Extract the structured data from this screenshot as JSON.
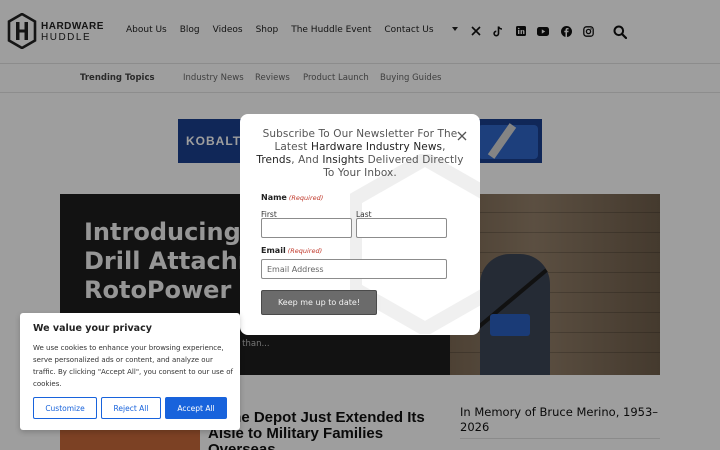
{
  "header": {
    "logo": {
      "line1": "HARDWARE",
      "line2": "HUDDLE"
    },
    "nav": [
      {
        "label": "About Us"
      },
      {
        "label": "Blog"
      },
      {
        "label": "Videos"
      },
      {
        "label": "Shop"
      },
      {
        "label": "The Huddle Event"
      },
      {
        "label": "Contact Us"
      }
    ],
    "social_icons": [
      "x-icon",
      "tiktok-icon",
      "linkedin-icon",
      "youtube-icon",
      "facebook-icon",
      "instagram-icon"
    ]
  },
  "trending": {
    "title": "Trending Topics",
    "items": [
      "Industry News",
      "Reviews",
      "Product Launch",
      "Buying Guides"
    ]
  },
  "banner": {
    "brand": "KOBALT"
  },
  "hero": {
    "title": "Introducing the Cleaner Drill Attachment from RotoPower",
    "subtitle": "...ing power at 1.0 GPM. That's more than..."
  },
  "stories": {
    "main_title": "Home Depot Just Extended Its Aisle to Military Families Overseas",
    "side_title": "In Memory of Bruce Merino, 1953–2026"
  },
  "newsletter": {
    "heading_parts": [
      {
        "text": "Subscribe To Our Newsletter For The Latest ",
        "hl": false
      },
      {
        "text": "Hardware Industry News",
        "hl": true
      },
      {
        "text": ", ",
        "hl": false
      },
      {
        "text": "Trends",
        "hl": true
      },
      {
        "text": ", And ",
        "hl": false
      },
      {
        "text": "Insights",
        "hl": true
      },
      {
        "text": " Delivered Directly To Your Inbox.",
        "hl": false
      }
    ],
    "name_label": "Name",
    "required": "(Required)",
    "first_label": "First",
    "last_label": "Last",
    "first_value": "",
    "last_value": "",
    "email_label": "Email",
    "email_placeholder": "Email Address",
    "email_value": "",
    "submit_label": "Keep me up to date!"
  },
  "cookie": {
    "title": "We value your privacy",
    "body": "We use cookies to enhance your browsing experience, serve personalized ads or content, and analyze our traffic. By clicking \"Accept All\", you consent to our use of cookies.",
    "customize": "Customize",
    "reject": "Reject All",
    "accept": "Accept All"
  },
  "colors": {
    "accent": "#1863dc",
    "overlay": "#000000",
    "kobalt_blue": "#1a3f8f"
  }
}
